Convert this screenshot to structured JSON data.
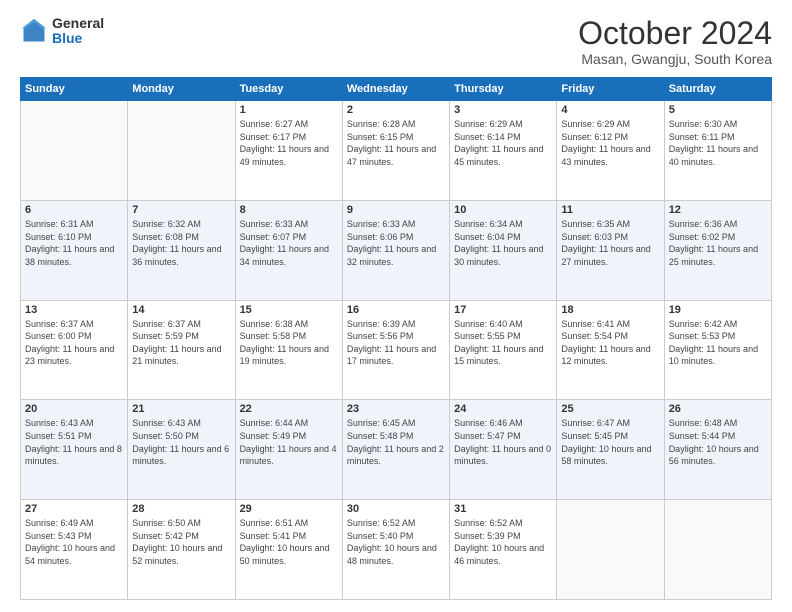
{
  "logo": {
    "general": "General",
    "blue": "Blue"
  },
  "header": {
    "month": "October 2024",
    "location": "Masan, Gwangju, South Korea"
  },
  "weekdays": [
    "Sunday",
    "Monday",
    "Tuesday",
    "Wednesday",
    "Thursday",
    "Friday",
    "Saturday"
  ],
  "weeks": [
    [
      {
        "day": "",
        "info": ""
      },
      {
        "day": "",
        "info": ""
      },
      {
        "day": "1",
        "info": "Sunrise: 6:27 AM\nSunset: 6:17 PM\nDaylight: 11 hours and 49 minutes."
      },
      {
        "day": "2",
        "info": "Sunrise: 6:28 AM\nSunset: 6:15 PM\nDaylight: 11 hours and 47 minutes."
      },
      {
        "day": "3",
        "info": "Sunrise: 6:29 AM\nSunset: 6:14 PM\nDaylight: 11 hours and 45 minutes."
      },
      {
        "day": "4",
        "info": "Sunrise: 6:29 AM\nSunset: 6:12 PM\nDaylight: 11 hours and 43 minutes."
      },
      {
        "day": "5",
        "info": "Sunrise: 6:30 AM\nSunset: 6:11 PM\nDaylight: 11 hours and 40 minutes."
      }
    ],
    [
      {
        "day": "6",
        "info": "Sunrise: 6:31 AM\nSunset: 6:10 PM\nDaylight: 11 hours and 38 minutes."
      },
      {
        "day": "7",
        "info": "Sunrise: 6:32 AM\nSunset: 6:08 PM\nDaylight: 11 hours and 36 minutes."
      },
      {
        "day": "8",
        "info": "Sunrise: 6:33 AM\nSunset: 6:07 PM\nDaylight: 11 hours and 34 minutes."
      },
      {
        "day": "9",
        "info": "Sunrise: 6:33 AM\nSunset: 6:06 PM\nDaylight: 11 hours and 32 minutes."
      },
      {
        "day": "10",
        "info": "Sunrise: 6:34 AM\nSunset: 6:04 PM\nDaylight: 11 hours and 30 minutes."
      },
      {
        "day": "11",
        "info": "Sunrise: 6:35 AM\nSunset: 6:03 PM\nDaylight: 11 hours and 27 minutes."
      },
      {
        "day": "12",
        "info": "Sunrise: 6:36 AM\nSunset: 6:02 PM\nDaylight: 11 hours and 25 minutes."
      }
    ],
    [
      {
        "day": "13",
        "info": "Sunrise: 6:37 AM\nSunset: 6:00 PM\nDaylight: 11 hours and 23 minutes."
      },
      {
        "day": "14",
        "info": "Sunrise: 6:37 AM\nSunset: 5:59 PM\nDaylight: 11 hours and 21 minutes."
      },
      {
        "day": "15",
        "info": "Sunrise: 6:38 AM\nSunset: 5:58 PM\nDaylight: 11 hours and 19 minutes."
      },
      {
        "day": "16",
        "info": "Sunrise: 6:39 AM\nSunset: 5:56 PM\nDaylight: 11 hours and 17 minutes."
      },
      {
        "day": "17",
        "info": "Sunrise: 6:40 AM\nSunset: 5:55 PM\nDaylight: 11 hours and 15 minutes."
      },
      {
        "day": "18",
        "info": "Sunrise: 6:41 AM\nSunset: 5:54 PM\nDaylight: 11 hours and 12 minutes."
      },
      {
        "day": "19",
        "info": "Sunrise: 6:42 AM\nSunset: 5:53 PM\nDaylight: 11 hours and 10 minutes."
      }
    ],
    [
      {
        "day": "20",
        "info": "Sunrise: 6:43 AM\nSunset: 5:51 PM\nDaylight: 11 hours and 8 minutes."
      },
      {
        "day": "21",
        "info": "Sunrise: 6:43 AM\nSunset: 5:50 PM\nDaylight: 11 hours and 6 minutes."
      },
      {
        "day": "22",
        "info": "Sunrise: 6:44 AM\nSunset: 5:49 PM\nDaylight: 11 hours and 4 minutes."
      },
      {
        "day": "23",
        "info": "Sunrise: 6:45 AM\nSunset: 5:48 PM\nDaylight: 11 hours and 2 minutes."
      },
      {
        "day": "24",
        "info": "Sunrise: 6:46 AM\nSunset: 5:47 PM\nDaylight: 11 hours and 0 minutes."
      },
      {
        "day": "25",
        "info": "Sunrise: 6:47 AM\nSunset: 5:45 PM\nDaylight: 10 hours and 58 minutes."
      },
      {
        "day": "26",
        "info": "Sunrise: 6:48 AM\nSunset: 5:44 PM\nDaylight: 10 hours and 56 minutes."
      }
    ],
    [
      {
        "day": "27",
        "info": "Sunrise: 6:49 AM\nSunset: 5:43 PM\nDaylight: 10 hours and 54 minutes."
      },
      {
        "day": "28",
        "info": "Sunrise: 6:50 AM\nSunset: 5:42 PM\nDaylight: 10 hours and 52 minutes."
      },
      {
        "day": "29",
        "info": "Sunrise: 6:51 AM\nSunset: 5:41 PM\nDaylight: 10 hours and 50 minutes."
      },
      {
        "day": "30",
        "info": "Sunrise: 6:52 AM\nSunset: 5:40 PM\nDaylight: 10 hours and 48 minutes."
      },
      {
        "day": "31",
        "info": "Sunrise: 6:52 AM\nSunset: 5:39 PM\nDaylight: 10 hours and 46 minutes."
      },
      {
        "day": "",
        "info": ""
      },
      {
        "day": "",
        "info": ""
      }
    ]
  ]
}
